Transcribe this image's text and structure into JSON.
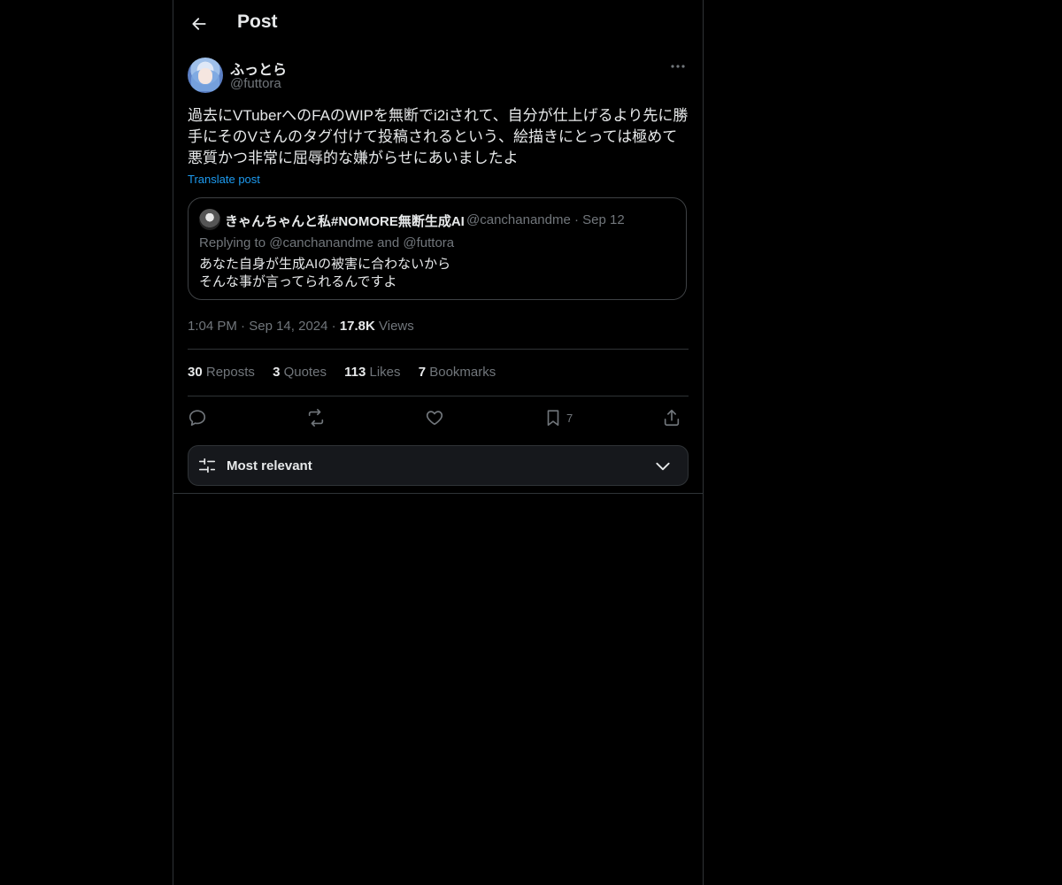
{
  "header": {
    "title": "Post"
  },
  "post": {
    "author": {
      "display_name": "ふっとら",
      "handle": "@futtora"
    },
    "text_lines": [
      "過去にVTuberへのFAのWIPを無断でi2iされて、自分が仕上げるより先に勝",
      "手にそのVさんのタグ付けて投稿されるという、絵描きにとっては極めて",
      "悪質かつ非常に屈辱的な嫌がらせにあいましたよ"
    ],
    "translate_label": "Translate post",
    "quote": {
      "display_name": "きゃんちゃんと私#NOMORE無断生成AI",
      "handle": "@canchanandme",
      "separator": "·",
      "date": "Sep 12",
      "replying_to": "Replying to @canchanandme and @futtora",
      "text_lines": [
        "あなた自身が生成AIの被害に合わないから",
        "そんな事が言ってられるんですよ"
      ]
    },
    "meta": {
      "time": "1:04 PM",
      "separator": "·",
      "date": "Sep 14, 2024",
      "views_count": "17.8K",
      "views_label": "Views"
    },
    "stats": {
      "reposts_count": "30",
      "reposts_label": "Reposts",
      "quotes_count": "3",
      "quotes_label": "Quotes",
      "likes_count": "113",
      "likes_label": "Likes",
      "bookmarks_count": "7",
      "bookmarks_label": "Bookmarks"
    },
    "actions": {
      "bookmark_count": "7"
    }
  },
  "sort": {
    "label": "Most relevant"
  },
  "icons": {
    "back": "arrow-left-icon",
    "more": "more-horizontal-icon",
    "reply": "reply-icon",
    "repost": "repost-icon",
    "like": "heart-icon",
    "bookmark": "bookmark-icon",
    "share": "share-icon",
    "sort": "sliders-icon",
    "chevron": "chevron-down-icon"
  },
  "colors": {
    "background": "#000000",
    "text": "#e7e9ea",
    "secondary": "#71767b",
    "link": "#1d9bf0",
    "border": "#2f3336"
  }
}
